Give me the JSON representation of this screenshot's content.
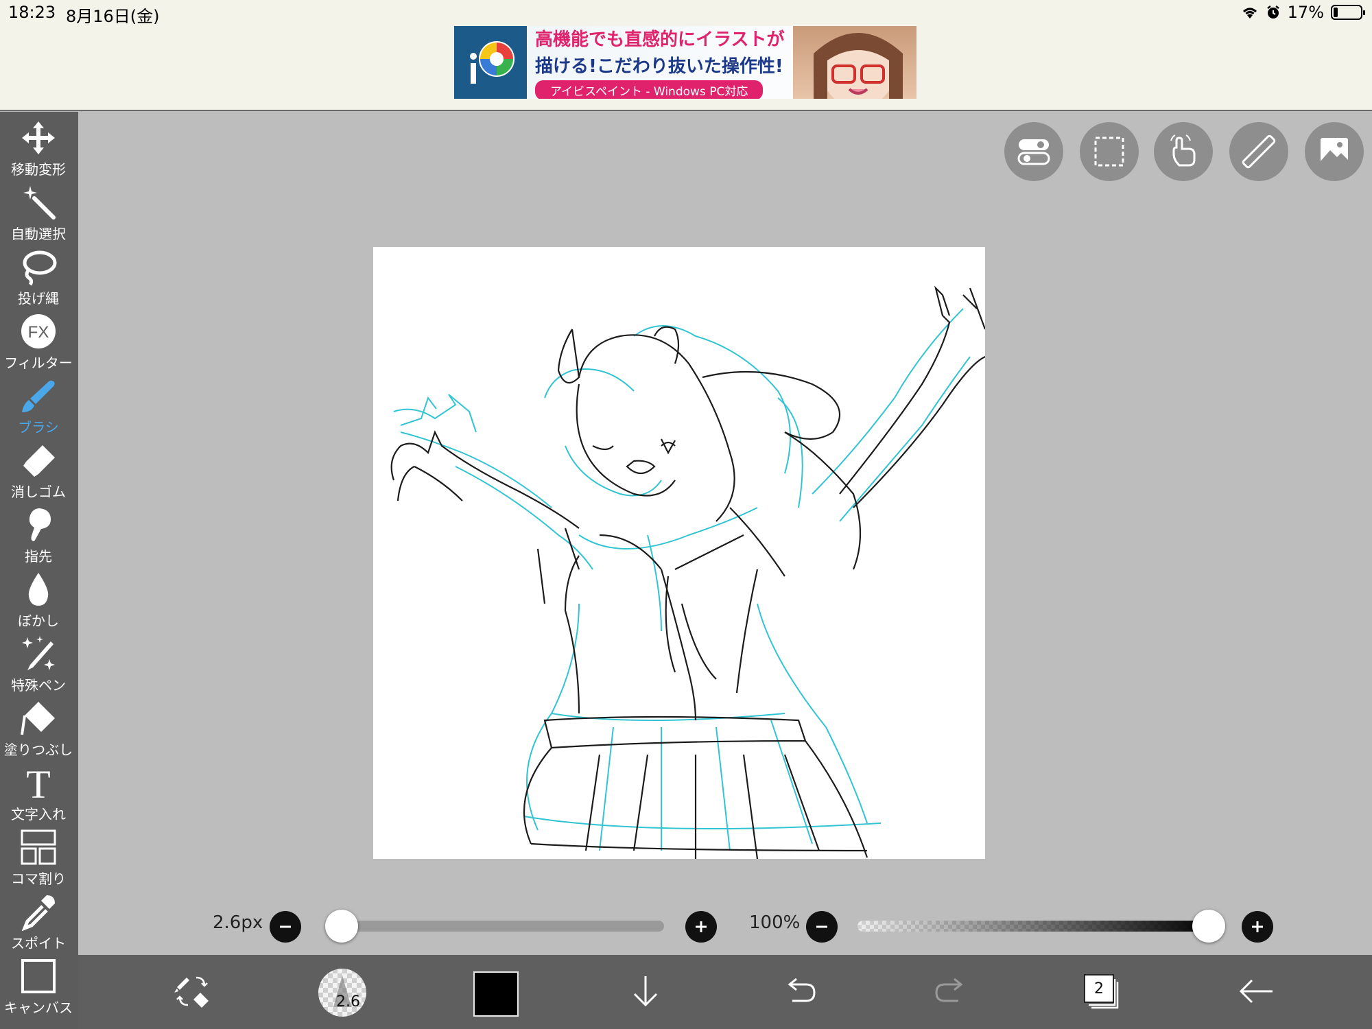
{
  "status_bar": {
    "time": "18:23",
    "date": "8月16日(金)",
    "battery": "17%"
  },
  "ad": {
    "line1": "高機能でも直感的にイラストが",
    "line2": "描ける!こだわり抜いた操作性!",
    "badge": "アイビスペイント - Windows PC対応"
  },
  "toolbar": {
    "items": [
      {
        "label": "移動変形",
        "icon": "move-icon"
      },
      {
        "label": "自動選択",
        "icon": "magic-wand-icon"
      },
      {
        "label": "投げ縄",
        "icon": "lasso-icon"
      },
      {
        "label": "フィルター",
        "icon": "filter-fx-icon",
        "icon_text": "FX"
      },
      {
        "label": "ブラシ",
        "icon": "brush-icon"
      },
      {
        "label": "消しゴム",
        "icon": "eraser-icon"
      },
      {
        "label": "指先",
        "icon": "smudge-finger-icon"
      },
      {
        "label": "ぼかし",
        "icon": "blur-drop-icon"
      },
      {
        "label": "特殊ペン",
        "icon": "special-pen-icon"
      },
      {
        "label": "塗りつぶし",
        "icon": "fill-bucket-icon"
      },
      {
        "label": "文字入れ",
        "icon": "text-icon",
        "icon_text": "T"
      },
      {
        "label": "コマ割り",
        "icon": "frame-divider-icon"
      },
      {
        "label": "スポイト",
        "icon": "eyedropper-icon"
      },
      {
        "label": "キャンバス",
        "icon": "canvas-icon"
      }
    ],
    "active": "ブラシ",
    "active_color": "#4aa7ea"
  },
  "sliders": {
    "brush_size": "2.6px",
    "brush_size_fraction": 0.0,
    "opacity": "100%",
    "opacity_fraction": 1.0
  },
  "bottom_bar": {
    "brush_size_value": "2.6",
    "current_color": "#000000",
    "layer_count": "2"
  }
}
